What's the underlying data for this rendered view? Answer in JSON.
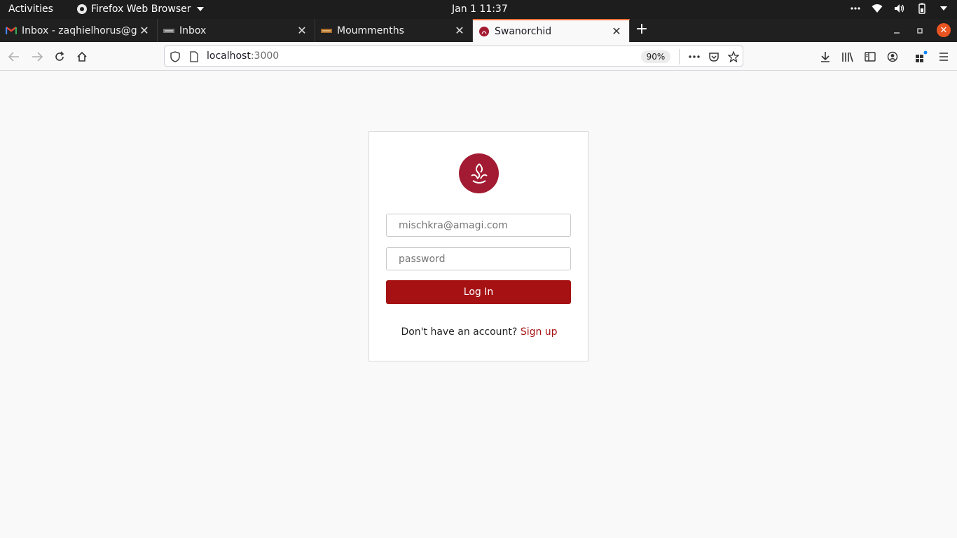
{
  "system_bar": {
    "activities": "Activities",
    "app_menu": "Firefox Web Browser",
    "clock": "Jan 1  11:37"
  },
  "tabs": [
    {
      "title": "Inbox - zaqhielhorus@gmail.com",
      "favicon": "gmail-icon"
    },
    {
      "title": "Inbox",
      "favicon": "mail-icon"
    },
    {
      "title": "Moummenths",
      "favicon": "site-icon"
    },
    {
      "title": "Swanorchid",
      "favicon": "swanorchid-icon",
      "active": true
    }
  ],
  "address_bar": {
    "host": "localhost",
    "port": ":3000",
    "zoom": "90%"
  },
  "login": {
    "email_placeholder": "mischkra@amagi.com",
    "password_placeholder": "password",
    "login_label": "Log In",
    "no_account_text": "Don't have an account?",
    "signup_label": "Sign up"
  },
  "colors": {
    "brand": "#a31b32",
    "button": "#a61214",
    "active_tab_accent": "#ff7139",
    "window_close": "#e95420"
  }
}
